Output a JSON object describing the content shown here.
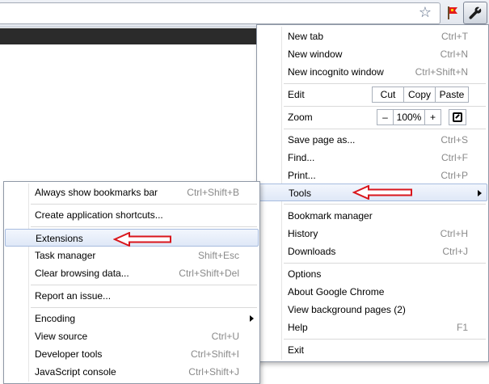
{
  "main_menu": {
    "new_tab": {
      "label": "New tab",
      "shortcut": "Ctrl+T"
    },
    "new_window": {
      "label": "New window",
      "shortcut": "Ctrl+N"
    },
    "new_incognito": {
      "label": "New incognito window",
      "shortcut": "Ctrl+Shift+N"
    },
    "edit": {
      "label": "Edit",
      "cut": "Cut",
      "copy": "Copy",
      "paste": "Paste"
    },
    "zoom": {
      "label": "Zoom",
      "minus": "–",
      "level": "100%",
      "plus": "+"
    },
    "save_page": {
      "label": "Save page as...",
      "shortcut": "Ctrl+S"
    },
    "find": {
      "label": "Find...",
      "shortcut": "Ctrl+F"
    },
    "print": {
      "label": "Print...",
      "shortcut": "Ctrl+P"
    },
    "tools": {
      "label": "Tools"
    },
    "bookmark_manager": {
      "label": "Bookmark manager"
    },
    "history": {
      "label": "History",
      "shortcut": "Ctrl+H"
    },
    "downloads": {
      "label": "Downloads",
      "shortcut": "Ctrl+J"
    },
    "options": {
      "label": "Options"
    },
    "about": {
      "label": "About Google Chrome"
    },
    "background_pages": {
      "label": "View background pages (2)"
    },
    "help": {
      "label": "Help",
      "shortcut": "F1"
    },
    "exit": {
      "label": "Exit"
    }
  },
  "tools_menu": {
    "bookmarks_bar": {
      "label": "Always show bookmarks bar",
      "shortcut": "Ctrl+Shift+B"
    },
    "app_shortcuts": {
      "label": "Create application shortcuts..."
    },
    "extensions": {
      "label": "Extensions"
    },
    "task_manager": {
      "label": "Task manager",
      "shortcut": "Shift+Esc"
    },
    "clear_data": {
      "label": "Clear browsing data...",
      "shortcut": "Ctrl+Shift+Del"
    },
    "report_issue": {
      "label": "Report an issue..."
    },
    "encoding": {
      "label": "Encoding"
    },
    "view_source": {
      "label": "View source",
      "shortcut": "Ctrl+U"
    },
    "dev_tools": {
      "label": "Developer tools",
      "shortcut": "Ctrl+Shift+I"
    },
    "js_console": {
      "label": "JavaScript console",
      "shortcut": "Ctrl+Shift+J"
    }
  },
  "icons": {
    "star": "star-icon",
    "extension": "red-flag-icon",
    "wrench": "wrench-icon"
  },
  "colors": {
    "highlight_bg": "#dfe8f7",
    "highlight_border": "#a7bcdf",
    "annotation_arrow": "#d9161c"
  }
}
